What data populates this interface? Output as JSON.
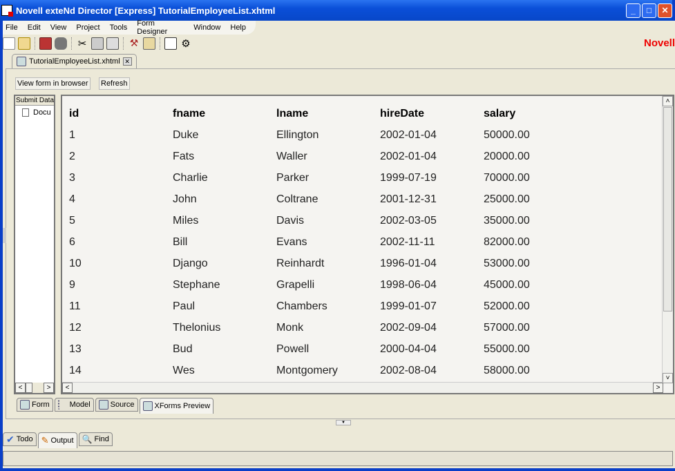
{
  "window": {
    "title": "Novell exteNd Director [Express] TutorialEmployeeList.xhtml",
    "brand": "Novell"
  },
  "menu": [
    "File",
    "Edit",
    "View",
    "Project",
    "Tools",
    "Form Designer",
    "Window",
    "Help"
  ],
  "editor_tab": "TutorialEmployeeList.xhtml",
  "buttons": {
    "view_form": "View form in browser",
    "refresh": "Refresh"
  },
  "left_panel": {
    "header": "Submit Data",
    "item": "Docu"
  },
  "table": {
    "columns": [
      "id",
      "fname",
      "lname",
      "hireDate",
      "salary"
    ],
    "rows": [
      [
        "1",
        "Duke",
        "Ellington",
        "2002-01-04",
        "50000.00"
      ],
      [
        "2",
        "Fats",
        "Waller",
        "2002-01-04",
        "20000.00"
      ],
      [
        "3",
        "Charlie",
        "Parker",
        "1999-07-19",
        "70000.00"
      ],
      [
        "4",
        "John",
        "Coltrane",
        "2001-12-31",
        "25000.00"
      ],
      [
        "5",
        "Miles",
        "Davis",
        "2002-03-05",
        "35000.00"
      ],
      [
        "6",
        "Bill",
        "Evans",
        "2002-11-11",
        "82000.00"
      ],
      [
        "10",
        "Django",
        "Reinhardt",
        "1996-01-04",
        "53000.00"
      ],
      [
        "9",
        "Stephane",
        "Grapelli",
        "1998-06-04",
        "45000.00"
      ],
      [
        "11",
        "Paul",
        "Chambers",
        "1999-01-07",
        "52000.00"
      ],
      [
        "12",
        "Thelonius",
        "Monk",
        "2002-09-04",
        "57000.00"
      ],
      [
        "13",
        "Bud",
        "Powell",
        "2000-04-04",
        "55000.00"
      ],
      [
        "14",
        "Wes",
        "Montgomery",
        "2002-08-04",
        "58000.00"
      ]
    ]
  },
  "view_tabs": [
    "Form",
    "Model",
    "Source",
    "XForms Preview"
  ],
  "output_tabs": [
    "Todo",
    "Output",
    "Find"
  ]
}
